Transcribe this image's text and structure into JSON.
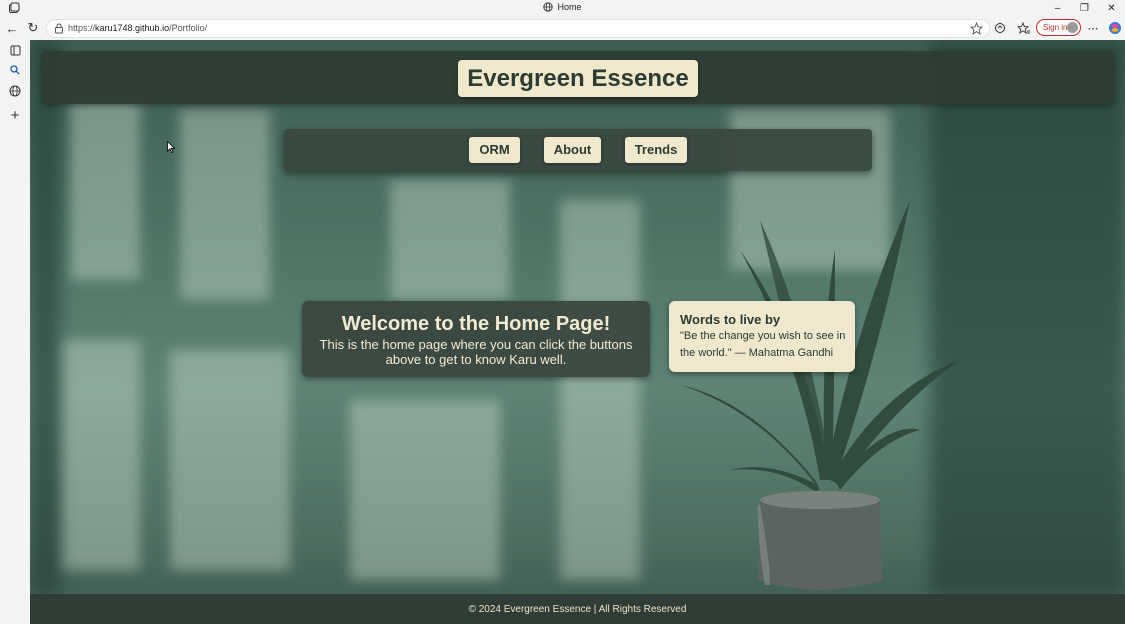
{
  "browser": {
    "tab_title": "Home",
    "url_prefix": "https://",
    "url_host": "karu1748.github.io",
    "url_path": "/Portfolio/",
    "signin_label": "Sign in",
    "icons": [
      "tab-actions-icon",
      "globe-icon",
      "minimize-icon",
      "restore-icon",
      "close-icon",
      "back-icon",
      "refresh-icon",
      "lock-icon",
      "favorite-star-icon",
      "extensions-icon",
      "favorites-icon",
      "more-icon",
      "copilot-icon"
    ]
  },
  "sidebar": {
    "icons": [
      "vertical-tabs-icon",
      "search-icon",
      "globe-icon",
      "add-icon"
    ]
  },
  "site": {
    "title": "Evergreen Essence",
    "nav": [
      {
        "label": "ORM"
      },
      {
        "label": "About"
      },
      {
        "label": "Trends"
      }
    ],
    "welcome": {
      "heading": "Welcome to the Home Page!",
      "body": "This is the home page where you can click the buttons above to get to know Karu well."
    },
    "quote": {
      "heading": "Words to live by",
      "text": "\"Be the change you wish to see in the world.\" — Mahatma Gandhi"
    },
    "footer": "© 2024 Evergreen Essence | All Rights Reserved"
  },
  "colors": {
    "accent_cream": "#efe8cc",
    "panel_dark_green": "#2f3d35",
    "text_dark": "#2d3b33"
  }
}
